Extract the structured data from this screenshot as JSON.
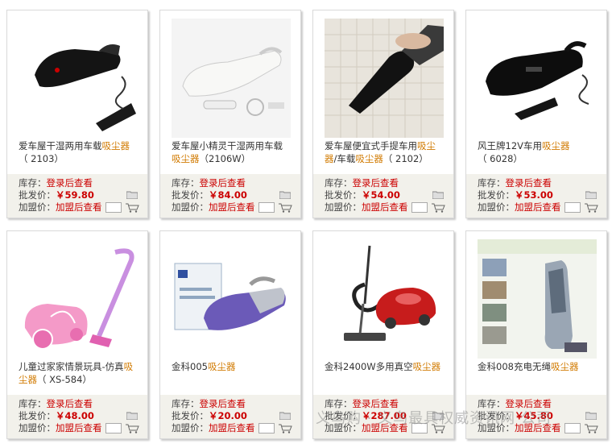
{
  "labels": {
    "stock": "库存：",
    "stock_value": "登录后查看",
    "wholesale": "批发价：",
    "member": "加盟价：",
    "member_value": "加盟后查看"
  },
  "products": [
    {
      "title_pre": "爱车屋干湿两用车载",
      "title_kw": "吸尘器",
      "title_post": "",
      "model": "（ 2103）",
      "price": "￥59.80"
    },
    {
      "title_pre": "爱车屋小精灵干湿两用车载",
      "title_kw": "吸尘器",
      "title_post": "",
      "model": "（2106W）",
      "price": "￥84.00"
    },
    {
      "title_pre": "爱车屋便宜式手提车用",
      "title_kw": "吸尘",
      "title_post": "器/车载",
      "title_kw2": "吸尘器",
      "model": "（ 2102）",
      "price": "￥54.00"
    },
    {
      "title_pre": "风王牌12V车用",
      "title_kw": "吸尘器",
      "title_post": "",
      "model": "（ 6028）",
      "price": "￥53.00"
    },
    {
      "title_pre": "儿童过家家情景玩具-仿真",
      "title_kw": "吸尘器",
      "title_post": "",
      "model": "（ XS-584）",
      "price": "￥48.00"
    },
    {
      "title_pre": "金科005",
      "title_kw": "吸尘器",
      "title_post": "",
      "model": "",
      "price": "￥20.00"
    },
    {
      "title_pre": "金科2400W多用真空",
      "title_kw": "吸尘器",
      "title_post": "",
      "model": "",
      "price": "￥287.00"
    },
    {
      "title_pre": "金科008充电无绳",
      "title_kw": "吸尘器",
      "title_post": "",
      "model": "",
      "price": "￥45.80"
    }
  ],
  "watermark": "义乌购 · 义乌最具权威资讯网 公司"
}
